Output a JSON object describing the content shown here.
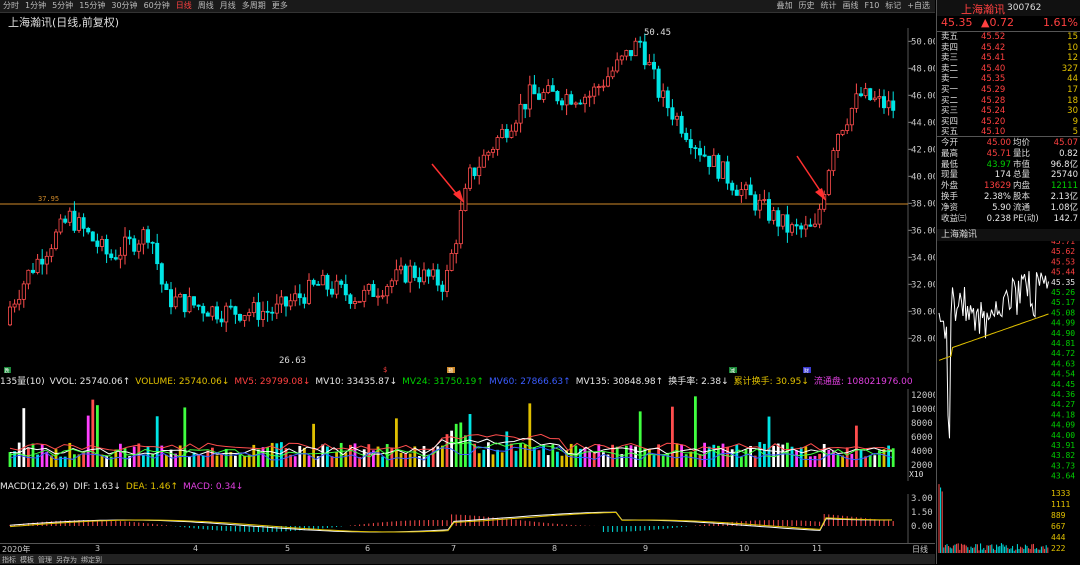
{
  "toolbar": {
    "periods": [
      "分时",
      "1分钟",
      "5分钟",
      "15分钟",
      "30分钟",
      "60分钟",
      "日线",
      "周线",
      "月线",
      "多周期",
      "更多"
    ],
    "active": "日线",
    "tools": [
      "叠加",
      "历史",
      "统计",
      "画线",
      "F10",
      "标记",
      "+自选"
    ]
  },
  "chart": {
    "title": "上海瀚讯(日线,前复权)",
    "price_axis": [
      "50.00",
      "48.00",
      "46.00",
      "44.00",
      "42.00",
      "40.00",
      "38.00",
      "36.00",
      "34.00",
      "32.00",
      "30.00",
      "28.00"
    ],
    "hline_label": "37.95",
    "high_label": "50.45",
    "low_label": "26.63",
    "markers": [
      "跌",
      "$",
      "预",
      "减",
      "财"
    ],
    "colors": {
      "up": "#ff4d4d",
      "down": "#00e5e5",
      "hline": "#d08a2a",
      "arrow": "#ff3030"
    }
  },
  "volume": {
    "labels": {
      "name": "135量(10)",
      "vvol": "VVOL: 25740.06↑",
      "volume": "VOLUME: 25740.06↓",
      "mv5": "MV5: 29799.08↓",
      "mv10": "MV10: 33435.87↓",
      "mv24": "MV24: 31750.19↑",
      "mv60": "MV60: 27866.63↑",
      "mv135": "MV135: 30848.98↑",
      "hs": "换手率: 2.38↓",
      "ljhs": "累计换手: 30.95↓",
      "ltp": "流通盘: 108021976.00"
    },
    "axis": [
      "12000",
      "10000",
      "8000",
      "6000",
      "4000",
      "2000"
    ],
    "unit": "X10"
  },
  "macd": {
    "labels": {
      "name": "MACD(12,26,9)",
      "dif": "DIF: 1.63↓",
      "dea": "DEA: 1.46↑",
      "macd": "MACD: 0.34↓"
    },
    "axis": [
      "3.00",
      "1.50",
      "0.00"
    ]
  },
  "dates": {
    "year": "2020年",
    "months": [
      "3",
      "4",
      "5",
      "6",
      "7",
      "8",
      "9",
      "10",
      "11"
    ],
    "tail": "日线"
  },
  "bottom_tabs": [
    "指标",
    "模板",
    "管理",
    "另存为",
    "绑定到"
  ],
  "quote": {
    "name": "上海瀚讯",
    "code": "300762",
    "price": "45.35",
    "change": "▲0.72",
    "pct": "1.61%",
    "asks": [
      {
        "label": "卖五",
        "price": "45.52",
        "vol": "15"
      },
      {
        "label": "卖四",
        "price": "45.42",
        "vol": "10"
      },
      {
        "label": "卖三",
        "price": "45.41",
        "vol": "12"
      },
      {
        "label": "卖二",
        "price": "45.40",
        "vol": "327"
      },
      {
        "label": "卖一",
        "price": "45.35",
        "vol": "44"
      }
    ],
    "bids": [
      {
        "label": "买一",
        "price": "45.29",
        "vol": "17"
      },
      {
        "label": "买二",
        "price": "45.28",
        "vol": "18"
      },
      {
        "label": "买三",
        "price": "45.24",
        "vol": "30"
      },
      {
        "label": "买四",
        "price": "45.20",
        "vol": "9"
      },
      {
        "label": "买五",
        "price": "45.10",
        "vol": "5"
      }
    ],
    "stats": [
      {
        "l1": "今开",
        "v1": "45.00",
        "c1": "red",
        "l2": "均价",
        "v2": "45.07",
        "c2": "red"
      },
      {
        "l1": "最高",
        "v1": "45.71",
        "c1": "red",
        "l2": "量比",
        "v2": "0.82",
        "c2": "white"
      },
      {
        "l1": "最低",
        "v1": "43.97",
        "c1": "green",
        "l2": "市值",
        "v2": "96.8亿",
        "c2": "white"
      },
      {
        "l1": "现量",
        "v1": "174",
        "c1": "white",
        "l2": "总量",
        "v2": "25740",
        "c2": "white"
      },
      {
        "l1": "外盘",
        "v1": "13629",
        "c1": "red",
        "l2": "内盘",
        "v2": "12111",
        "c2": "green"
      },
      {
        "l1": "换手",
        "v1": "2.38%",
        "c1": "white",
        "l2": "股本",
        "v2": "2.13亿",
        "c2": "white"
      },
      {
        "l1": "净资",
        "v1": "5.90",
        "c1": "white",
        "l2": "流通",
        "v2": "1.08亿",
        "c2": "white"
      },
      {
        "l1": "收益㈢",
        "v1": "0.238",
        "c1": "white",
        "l2": "PE(动)",
        "v2": "142.7",
        "c2": "white"
      }
    ],
    "mini_title": "上海瀚讯",
    "mini_axis": [
      "45.71",
      "45.62",
      "45.53",
      "45.44",
      "45.35",
      "45.26",
      "45.17",
      "45.08",
      "44.99",
      "44.90",
      "44.81",
      "44.72",
      "44.63",
      "44.54",
      "44.45",
      "44.36",
      "44.27",
      "44.18",
      "44.09",
      "44.00",
      "43.91",
      "43.82",
      "43.73",
      "43.64"
    ],
    "mini_vol_axis": [
      "1333",
      "1111",
      "889",
      "667",
      "444",
      "222"
    ]
  }
}
